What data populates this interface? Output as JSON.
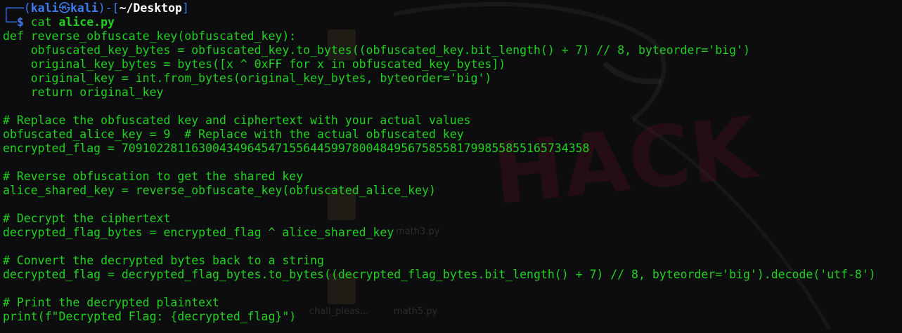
{
  "prompt": {
    "frame_open": "┌──(",
    "user": "kali",
    "skull": "㉿",
    "host": "kali",
    "frame_mid": ")-[",
    "path": "~/Desktop",
    "frame_close": "]",
    "line2_frame": "└─",
    "dollar": "$",
    "command": "cat",
    "argument": "alice.py"
  },
  "file_lines": [
    "def reverse_obfuscate_key(obfuscated_key):",
    "    obfuscated_key_bytes = obfuscated_key.to_bytes((obfuscated_key.bit_length() + 7) // 8, byteorder='big')",
    "    original_key_bytes = bytes([x ^ 0xFF for x in obfuscated_key_bytes])",
    "    original_key = int.from_bytes(original_key_bytes, byteorder='big')",
    "    return original_key",
    "",
    "# Replace the obfuscated key and ciphertext with your actual values",
    "obfuscated_alice_key = 9  # Replace with the actual obfuscated key",
    "encrypted_flag = 7091022811630043496454715564459978004849567585581799855855165734358",
    "",
    "# Reverse obfuscation to get the shared key",
    "alice_shared_key = reverse_obfuscate_key(obfuscated_alice_key)",
    "",
    "# Decrypt the ciphertext",
    "decrypted_flag_bytes = encrypted_flag ^ alice_shared_key",
    "",
    "# Convert the decrypted bytes back to a string",
    "decrypted_flag = decrypted_flag_bytes.to_bytes((decrypted_flag_bytes.bit_length() + 7) // 8, byteorder='big').decode('utf-8')",
    "",
    "# Print the decrypted plaintext",
    "print(f\"Decrypted Flag: {decrypted_flag}\")"
  ],
  "desktop_icons": [
    {
      "label": "math3.py"
    },
    {
      "label": "chall_pleas..."
    },
    {
      "label": "math5.py"
    }
  ],
  "colors": {
    "terminal_text": "#20d11f",
    "prompt_blue": "#3d7cf2",
    "background": "#0d0d0f"
  }
}
